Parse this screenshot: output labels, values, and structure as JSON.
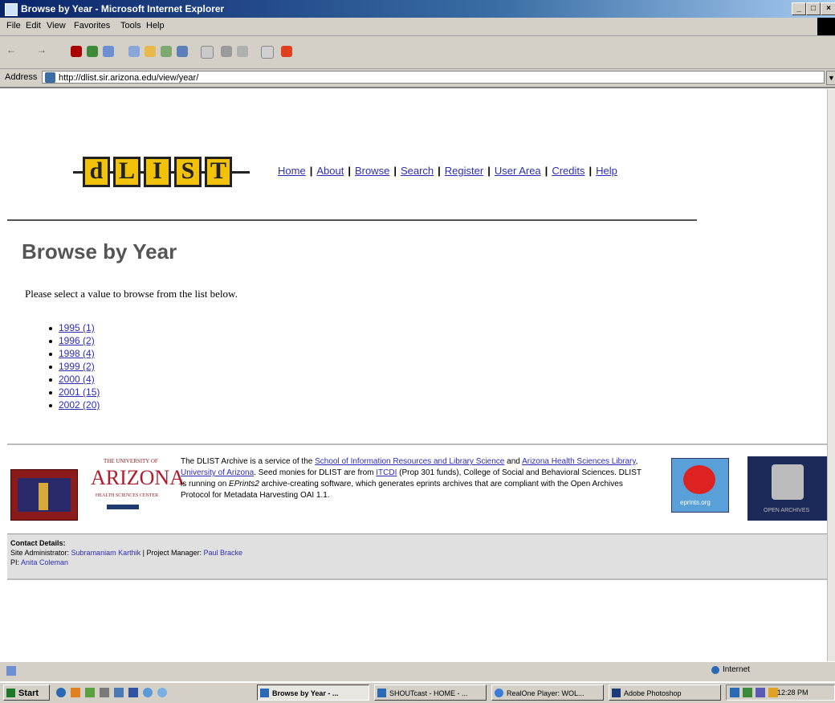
{
  "window": {
    "title": "Browse by Year - Microsoft Internet Explorer",
    "controls": [
      "_",
      "□",
      "×"
    ]
  },
  "menu": [
    "File",
    "Edit",
    "View",
    "Favorites",
    "Tools",
    "Help"
  ],
  "address": {
    "label": "Address",
    "url": "http://dlist.sir.arizona.edu/view/year/"
  },
  "site": {
    "logo_letters": [
      "d",
      "L",
      "I",
      "S",
      "T"
    ],
    "nav": [
      "Home",
      "About",
      "Browse",
      "Search",
      "Register",
      "User Area",
      "Credits",
      "Help"
    ]
  },
  "page": {
    "title": "Browse by Year",
    "intro": "Please select a value to browse from the list below.",
    "years": [
      "1995 (1)",
      "1996 (2)",
      "1998 (4)",
      "1999 (2)",
      "2000 (4)",
      "2001 (15)",
      "2002 (20)"
    ]
  },
  "footer": {
    "text_parts": {
      "p1": "The DLIST Archive is a service of the ",
      "link1": "School of Information Resources and Library Science",
      "p2": " and ",
      "link2": "Arizona Health Sciences Library",
      "p3": ", ",
      "link3": "University of Arizona",
      "p4": ". Seed monies for DLIST are from ",
      "link4": "ITCDI",
      "p5": " (Prop 301 funds), College of Social and Behavioral Sciences. DLIST is running on ",
      "italic": "EPrints2",
      "p6": " archive-creating software, which generates eprints archives that are compliant with the Open Archives Protocol for Metadata Harvesting OAI 1.1."
    },
    "arizona_logo": {
      "top": "THE UNIVERSITY OF",
      "main": "ARIZONA",
      "sub": "HEALTH SCIENCES CENTER"
    },
    "eprints_label": "eprints.org",
    "oai_label": "OPEN ARCHIVES"
  },
  "contact": {
    "heading": "Contact Details:",
    "admin_label": "Site Administrator:",
    "admin_name": "Subramaniam Karthik",
    "pm_label": "| Project Manager:",
    "pm_name": "Paul Bracke",
    "pi_label": "PI:",
    "pi_name": "Anita Coleman"
  },
  "status": {
    "zone": "Internet"
  },
  "taskbar": {
    "start": "Start",
    "tasks": [
      "Browse by Year - ...",
      "SHOUTcast - HOME - ...",
      "RealOne Player: WOL...",
      "Adobe Photoshop"
    ],
    "clock": "12:28 PM"
  }
}
